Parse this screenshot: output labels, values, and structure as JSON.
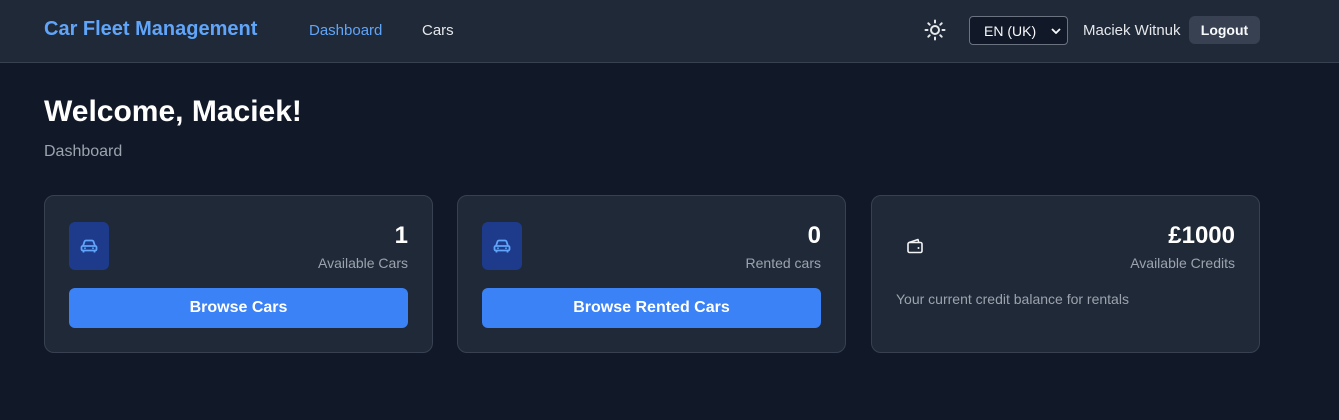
{
  "header": {
    "brand": "Car Fleet Management",
    "nav": [
      {
        "label": "Dashboard",
        "active": true
      },
      {
        "label": "Cars",
        "active": false
      }
    ],
    "theme_icon": "sun-icon",
    "language": {
      "selected": "EN (UK)"
    },
    "user_name": "Maciek Witnuk",
    "logout_label": "Logout"
  },
  "main": {
    "welcome": "Welcome, Maciek!",
    "subtitle": "Dashboard",
    "cards": [
      {
        "icon": "car-icon",
        "value": "1",
        "label": "Available Cars",
        "button": "Browse Cars"
      },
      {
        "icon": "car-icon",
        "value": "0",
        "label": "Rented cars",
        "button": "Browse Rented Cars"
      },
      {
        "icon": "wallet-icon",
        "value": "£1000",
        "label": "Available Credits",
        "description": "Your current credit balance for rentals"
      }
    ]
  },
  "colors": {
    "accent": "#3b82f6",
    "brand": "#60a5fa",
    "background": "#111827",
    "surface": "#1f2937",
    "icon_bg": "#1e3a8a"
  }
}
